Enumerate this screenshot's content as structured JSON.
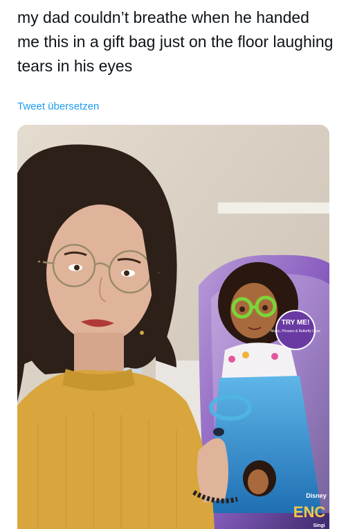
{
  "tweet": {
    "text": "my dad couldn’t breathe when he handed me this in a gift bag just on the floor laughing tears in his eyes",
    "translate_label": "Tweet übersetzen"
  },
  "media": {
    "box_callout": "TRY ME!",
    "box_callout_sub": "Music, Phrases & Butterfly Glow",
    "box_brand": "Disney",
    "box_logo": "ENC",
    "box_footer": "Singi"
  },
  "colors": {
    "text": "#0f1419",
    "link": "#1d9bf0",
    "wall": "#d8cfc2",
    "sweater": "#d9a53d",
    "package_purple": "#7b4fa8"
  }
}
